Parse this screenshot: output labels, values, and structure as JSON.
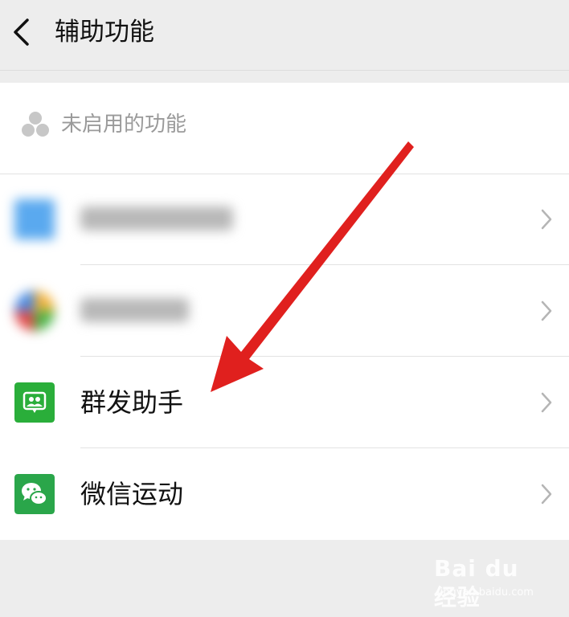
{
  "header": {
    "title": "辅助功能",
    "back_icon": "chevron-left-icon"
  },
  "section": {
    "label": "未启用的功能",
    "icon": "three-dots-cluster-icon"
  },
  "rows": [
    {
      "label": "",
      "icon": "blurred-app-icon-blue",
      "blurred": true
    },
    {
      "label": "",
      "icon": "blurred-app-icon-multicolor",
      "blurred": true
    },
    {
      "label": "群发助手",
      "icon": "group-message-icon",
      "color": "#2aae3a"
    },
    {
      "label": "微信运动",
      "icon": "wechat-chat-bubbles-icon",
      "color": "#2aa64a"
    }
  ],
  "annotation": {
    "arrow_color": "#e0201e"
  },
  "watermark": {
    "main": "Bai du 经验",
    "sub": "jingyan.baidu.com"
  },
  "colors": {
    "background": "#ededed",
    "card": "#ffffff",
    "chevron": "#b5b5b5"
  }
}
